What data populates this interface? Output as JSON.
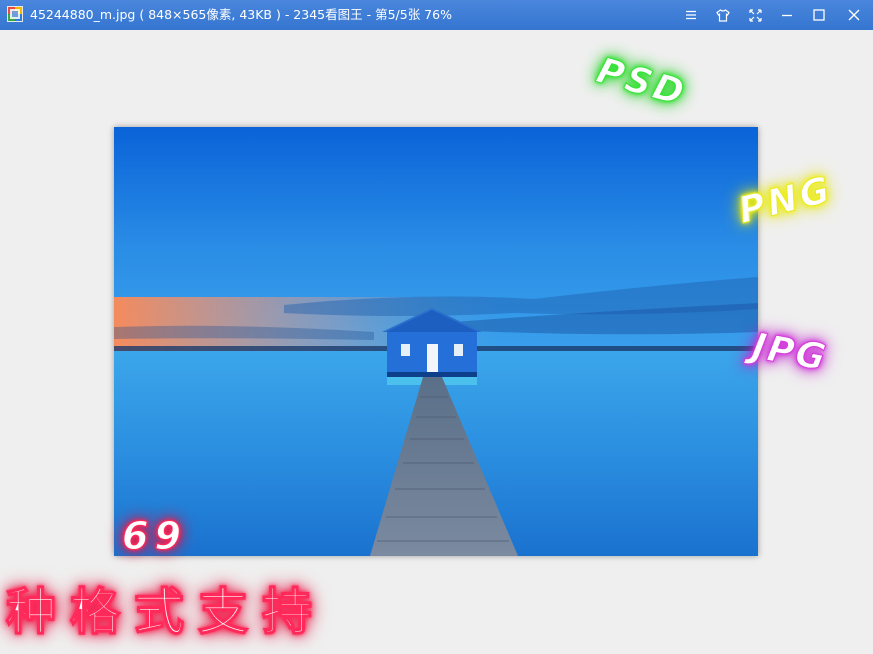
{
  "window": {
    "title": "45244880_m.jpg ( 848×565像素, 43KB ) - 2345看图王 - 第5/5张 76%",
    "buttons": {
      "menu": "menu-icon",
      "skin": "shirt-icon",
      "fullscreen": "expand-icon",
      "minimize": "minimize-icon",
      "maximize": "maximize-icon",
      "close": "close-icon"
    }
  },
  "colors": {
    "titlebar": "#3a7bd5",
    "background": "#efefef",
    "psd_glow": "#2ee82e",
    "png_glow": "#f2f21a",
    "jpg_glow": "#d83ae0",
    "cn_glow": "#ff2a5a"
  },
  "overlay": {
    "psd": "PSD",
    "png": "PNG",
    "jpg": "JPG",
    "count": "69",
    "formats": "种格式支持"
  }
}
